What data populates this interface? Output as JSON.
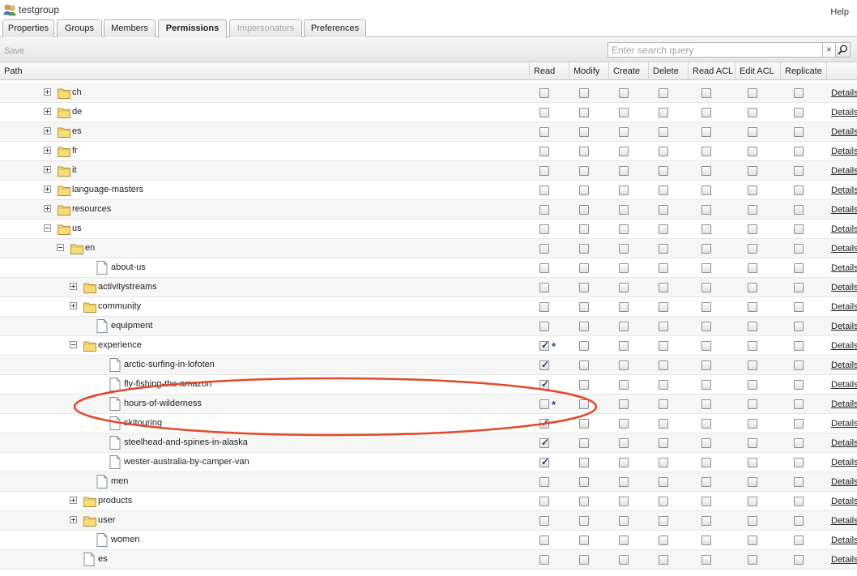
{
  "window": {
    "title": "testgroup",
    "help_label": "Help"
  },
  "tabs": [
    {
      "label": "Properties",
      "state": "normal"
    },
    {
      "label": "Groups",
      "state": "normal"
    },
    {
      "label": "Members",
      "state": "normal"
    },
    {
      "label": "Permissions",
      "state": "active"
    },
    {
      "label": "Impersonators",
      "state": "disabled"
    },
    {
      "label": "Preferences",
      "state": "normal"
    }
  ],
  "toolbar": {
    "save_label": "Save",
    "search_placeholder": "Enter search query",
    "clear_glyph": "×"
  },
  "columns": {
    "path": "Path",
    "read": "Read",
    "modify": "Modify",
    "create": "Create",
    "delete": "Delete",
    "read_acl": "Read ACL",
    "edit_acl": "Edit ACL",
    "replicate": "Replicate"
  },
  "details_label": "Details",
  "colors": {
    "annotation": "#e2492b",
    "check": "#22347a"
  },
  "rows": [
    {
      "label": "ch",
      "level": 0,
      "type": "folder",
      "expander": "plus",
      "read": false,
      "asterisk": false
    },
    {
      "label": "de",
      "level": 0,
      "type": "folder",
      "expander": "plus",
      "read": false,
      "asterisk": false
    },
    {
      "label": "es",
      "level": 0,
      "type": "folder",
      "expander": "plus",
      "read": false,
      "asterisk": false
    },
    {
      "label": "fr",
      "level": 0,
      "type": "folder",
      "expander": "plus",
      "read": false,
      "asterisk": false
    },
    {
      "label": "it",
      "level": 0,
      "type": "folder",
      "expander": "plus",
      "read": false,
      "asterisk": false
    },
    {
      "label": "language-masters",
      "level": 0,
      "type": "folder",
      "expander": "plus",
      "read": false,
      "asterisk": false
    },
    {
      "label": "resources",
      "level": 0,
      "type": "folder",
      "expander": "plus",
      "read": false,
      "asterisk": false
    },
    {
      "label": "us",
      "level": 0,
      "type": "folder",
      "expander": "minus",
      "read": false,
      "asterisk": false
    },
    {
      "label": "en",
      "level": 1,
      "type": "folder",
      "expander": "minus",
      "read": false,
      "asterisk": false
    },
    {
      "label": "about-us",
      "level": 2,
      "type": "page",
      "expander": "none",
      "read": false,
      "asterisk": false
    },
    {
      "label": "activitystreams",
      "level": 2,
      "type": "folder",
      "expander": "plus",
      "read": false,
      "asterisk": false
    },
    {
      "label": "community",
      "level": 2,
      "type": "folder",
      "expander": "plus",
      "read": false,
      "asterisk": false
    },
    {
      "label": "equipment",
      "level": 2,
      "type": "page",
      "expander": "none",
      "read": false,
      "asterisk": false
    },
    {
      "label": "experience",
      "level": 2,
      "type": "folder",
      "expander": "minus",
      "read": true,
      "asterisk": true
    },
    {
      "label": "arctic-surfing-in-lofoten",
      "level": 3,
      "type": "page",
      "expander": "none",
      "read": true,
      "asterisk": false
    },
    {
      "label": "fly-fishing-the-amazon",
      "level": 3,
      "type": "page",
      "expander": "none",
      "read": true,
      "asterisk": false
    },
    {
      "label": "hours-of-wilderness",
      "level": 3,
      "type": "page",
      "expander": "none",
      "read": false,
      "asterisk": true
    },
    {
      "label": "skitouring",
      "level": 3,
      "type": "page",
      "expander": "none",
      "read": true,
      "asterisk": false
    },
    {
      "label": "steelhead-and-spines-in-alaska",
      "level": 3,
      "type": "page",
      "expander": "none",
      "read": true,
      "asterisk": false
    },
    {
      "label": "wester-australia-by-camper-van",
      "level": 3,
      "type": "page",
      "expander": "none",
      "read": true,
      "asterisk": false
    },
    {
      "label": "men",
      "level": 2,
      "type": "page",
      "expander": "none",
      "read": false,
      "asterisk": false
    },
    {
      "label": "products",
      "level": 2,
      "type": "folder",
      "expander": "plus",
      "read": false,
      "asterisk": false
    },
    {
      "label": "user",
      "level": 2,
      "type": "folder",
      "expander": "plus",
      "read": false,
      "asterisk": false
    },
    {
      "label": "women",
      "level": 2,
      "type": "page",
      "expander": "none",
      "read": false,
      "asterisk": false
    },
    {
      "label": "es",
      "level": 1,
      "type": "page",
      "expander": "none",
      "read": false,
      "asterisk": false
    }
  ]
}
